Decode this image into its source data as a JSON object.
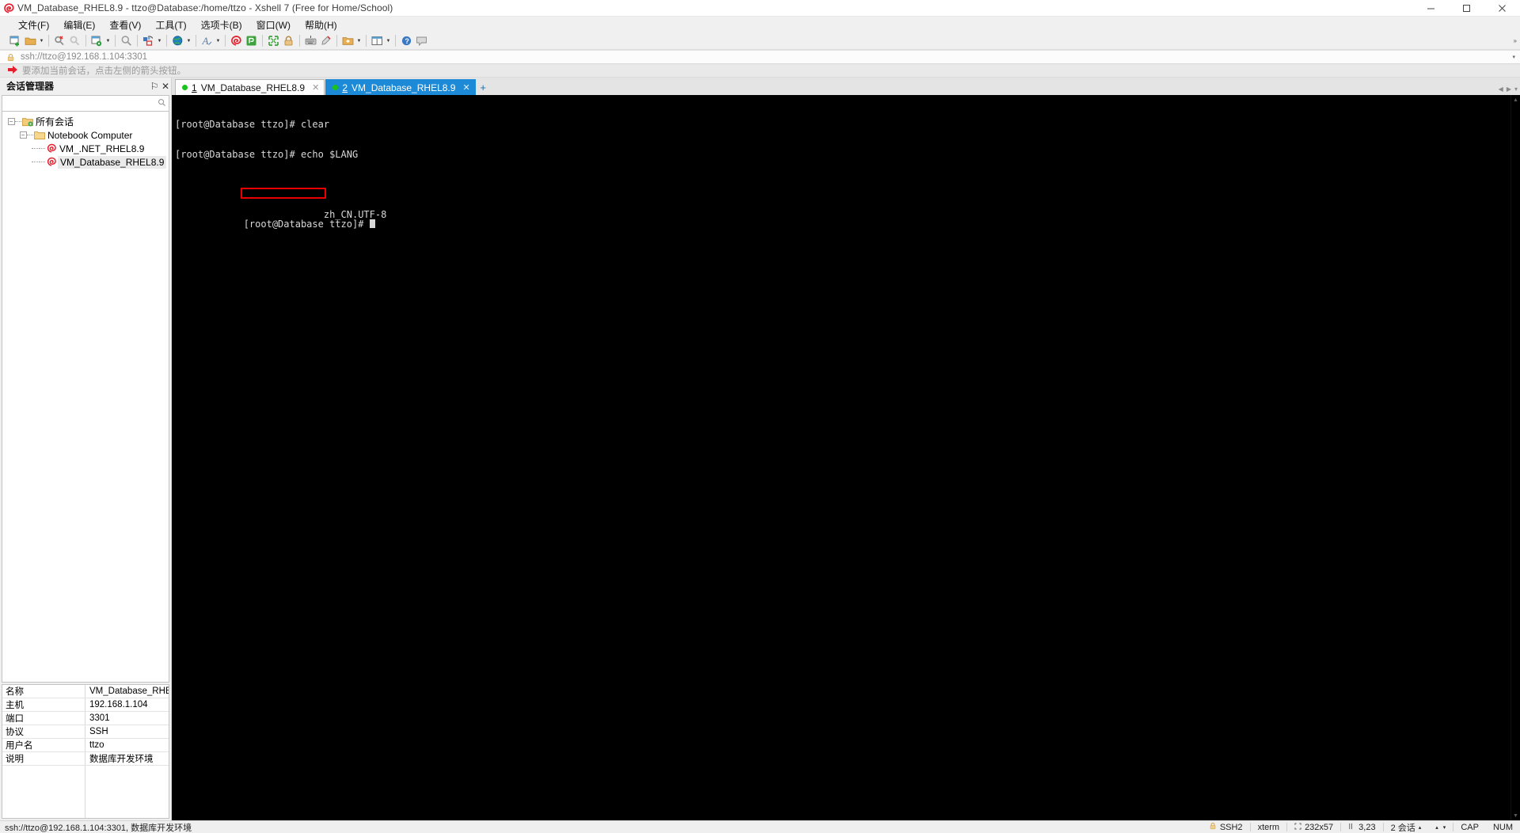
{
  "window": {
    "title": "VM_Database_RHEL8.9 - ttzo@Database:/home/ttzo - Xshell 7 (Free for Home/School)",
    "app_icon": "xshell-logo-icon",
    "minimize_label": "─",
    "maximize_label": "☐",
    "close_label": "✕"
  },
  "menubar": {
    "items": [
      {
        "label": "文件(F)",
        "name": "menu-file"
      },
      {
        "label": "编辑(E)",
        "name": "menu-edit"
      },
      {
        "label": "查看(V)",
        "name": "menu-view"
      },
      {
        "label": "工具(T)",
        "name": "menu-tools"
      },
      {
        "label": "选项卡(B)",
        "name": "menu-tabs"
      },
      {
        "label": "窗口(W)",
        "name": "menu-window"
      },
      {
        "label": "帮助(H)",
        "name": "menu-help"
      }
    ],
    "overflow_caret": "▾"
  },
  "toolbar": {
    "buttons": [
      "new-session-icon",
      "open-folder-icon",
      "disconnect-icon",
      "reconnect-icon",
      "session-properties-icon",
      "find-icon",
      "layout-icon",
      "globe-icon",
      "font-icon",
      "xshell-icon",
      "xftp-icon",
      "fullscreen-icon",
      "lock-icon",
      "keyboard-icon",
      "highlight-icon",
      "add-folder-icon",
      "tile-icon"
    ],
    "overflow_caret": "»"
  },
  "addressbar": {
    "lock_icon": "lock-icon",
    "value": "ssh://ttzo@192.168.1.104:3301",
    "dropdown_caret": "▾"
  },
  "hintbar": {
    "arrow_icon": "red-arrow-icon",
    "text": "要添加当前会话，点击左侧的箭头按钮。"
  },
  "session_panel": {
    "title": "会话管理器",
    "pin_label": "⚐",
    "close_label": "✕",
    "search_icon": "search-icon",
    "tree": [
      {
        "label": "所有会话",
        "level": 0,
        "icon": "all-sessions-folder-icon",
        "expanded": true,
        "selected": false
      },
      {
        "label": "Notebook Computer",
        "level": 1,
        "icon": "folder-icon",
        "expanded": true,
        "selected": false
      },
      {
        "label": "VM_.NET_RHEL8.9",
        "level": 2,
        "icon": "session-icon",
        "expanded": false,
        "selected": false
      },
      {
        "label": "VM_Database_RHEL8.9",
        "level": 2,
        "icon": "session-icon",
        "expanded": false,
        "selected": true
      }
    ]
  },
  "properties": {
    "rows": [
      {
        "key": "名称",
        "value": "VM_Database_RHE..."
      },
      {
        "key": "主机",
        "value": "192.168.1.104"
      },
      {
        "key": "端口",
        "value": "3301"
      },
      {
        "key": "协议",
        "value": "SSH"
      },
      {
        "key": "用户名",
        "value": "ttzo"
      },
      {
        "key": "说明",
        "value": "数据库开发环境"
      }
    ]
  },
  "tabs": {
    "items": [
      {
        "num": "1",
        "label": "VM_Database_RHEL8.9",
        "active": false,
        "status": "connected",
        "close_label": "✕"
      },
      {
        "num": "2",
        "label": "VM_Database_RHEL8.9",
        "active": true,
        "status": "connected",
        "close_label": "✕"
      }
    ],
    "add_label": "+",
    "nav_prev": "◀",
    "nav_next": "▶",
    "nav_menu": "▾"
  },
  "terminal": {
    "lines": [
      {
        "text": "[root@Database ttzo]# clear",
        "highlight": false
      },
      {
        "text": "[root@Database ttzo]# echo $LANG",
        "highlight": false
      },
      {
        "text": "zh_CN.UTF-8",
        "highlight": true
      },
      {
        "text": "[root@Database ttzo]# ",
        "highlight": false,
        "cursor": true
      }
    ],
    "highlight_color": "#e80000",
    "background": "#000000",
    "foreground": "#d8d8d8",
    "scroll_up": "▲",
    "scroll_down": "▼"
  },
  "statusbar": {
    "left": "ssh://ttzo@192.168.1.104:3301, 数据库开发环境",
    "lock_icon": "lock-icon",
    "protocol": "SSH2",
    "terminal_type": "xterm",
    "size_icon": "size-icon",
    "size": "232x57",
    "cursor_icon": "cursor-icon",
    "cursor": "3,23",
    "sessions": "2 会话",
    "sessions_caret": "▴",
    "up_caret": "▴",
    "down_caret": "▾",
    "cap": "CAP",
    "num": "NUM"
  }
}
